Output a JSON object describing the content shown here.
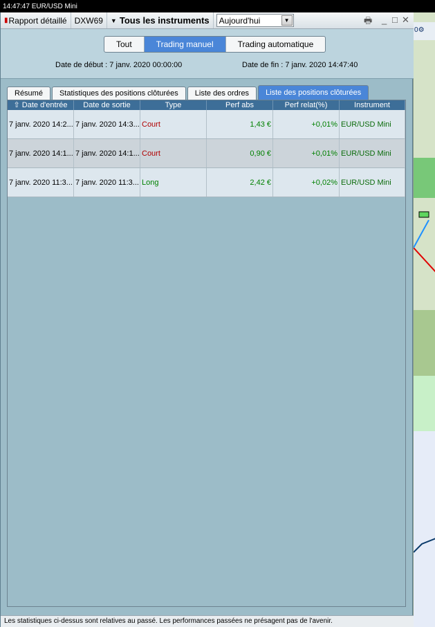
{
  "background": {
    "top_text": "14:47:47 EUR/USD Mini",
    "toolbar_text": "0"
  },
  "titlebar": {
    "report_label": "Rapport détaillé",
    "account_label": "DXW69",
    "instruments_label": "Tous les instruments",
    "period_value": "Aujourd'hui"
  },
  "segments": {
    "all": "Tout",
    "manual": "Trading manuel",
    "auto": "Trading automatique"
  },
  "dates": {
    "start": "Date de début : 7 janv. 2020 00:00:00",
    "end": "Date de fin : 7 janv. 2020 14:47:40"
  },
  "tabs": {
    "summary": "Résumé",
    "stats": "Statistiques des positions clôturées",
    "orders": "Liste des ordres",
    "positions": "Liste des positions clôturées"
  },
  "table": {
    "headers": [
      "⇧ Date d'entrée",
      "Date de sortie",
      "Type",
      "Perf abs",
      "Perf relat(%)",
      "Instrument"
    ],
    "rows": [
      {
        "entry": "7 janv. 2020 14:2...",
        "exit": "7 janv. 2020 14:3...",
        "type": "Court",
        "abs": "1,43 €",
        "rel": "+0,01%",
        "instrument": "EUR/USD Mini"
      },
      {
        "entry": "7 janv. 2020 14:1...",
        "exit": "7 janv. 2020 14:1...",
        "type": "Court",
        "abs": "0,90 €",
        "rel": "+0,01%",
        "instrument": "EUR/USD Mini"
      },
      {
        "entry": "7 janv. 2020 11:3...",
        "exit": "7 janv. 2020 11:3...",
        "type": "Long",
        "abs": "2,42 €",
        "rel": "+0,02%",
        "instrument": "EUR/USD Mini"
      }
    ]
  },
  "status": {
    "disclaimer": "Les statistiques ci-dessus sont relatives au passé. Les performances passées ne présagent pas de l'avenir."
  },
  "colors": {
    "accent": "#4a86d8",
    "header": "#3d6e98",
    "panel": "#9cbcc8",
    "short": "#b00000",
    "long": "#008000"
  }
}
